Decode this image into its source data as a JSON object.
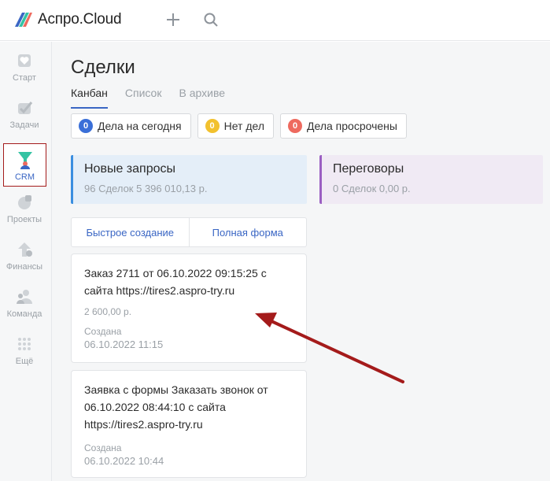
{
  "app": {
    "name": "Аспро.Cloud"
  },
  "topbar": {
    "icons": [
      "plus-icon",
      "search-icon"
    ]
  },
  "sidebar": {
    "items": [
      {
        "label": "Старт",
        "icon": "heart-icon"
      },
      {
        "label": "Задачи",
        "icon": "checkmark-icon"
      },
      {
        "label": "CRM",
        "icon": "funnel-icon",
        "active": true
      },
      {
        "label": "Проекты",
        "icon": "projects-icon"
      },
      {
        "label": "Финансы",
        "icon": "finance-icon"
      },
      {
        "label": "Команда",
        "icon": "team-icon"
      },
      {
        "label": "Ещё",
        "icon": "grid-dots-icon"
      }
    ]
  },
  "page": {
    "title": "Сделки",
    "tabs": [
      {
        "label": "Канбан",
        "active": true
      },
      {
        "label": "Список"
      },
      {
        "label": "В архиве"
      }
    ],
    "filters": [
      {
        "count": "0",
        "label": "Дела на сегодня",
        "color": "#3a6fd8"
      },
      {
        "count": "0",
        "label": "Нет дел",
        "color": "#f2c12e"
      },
      {
        "count": "0",
        "label": "Дела просрочены",
        "color": "#ee6a5f"
      }
    ]
  },
  "columns": [
    {
      "title": "Новые запросы",
      "meta": "96 Сделок   5 396 010,13 р.",
      "color": "#3a8ee0"
    },
    {
      "title": "Переговоры",
      "meta": "0 Сделок   0,00 р.",
      "color": "#9b5fc2"
    }
  ],
  "quick_actions": {
    "quick": "Быстрое создание",
    "full": "Полная форма"
  },
  "cards": [
    {
      "title": "Заказ 2711 от 06.10.2022 09:15:25 с сайта https://tires2.aspro-try.ru",
      "amount": "2 600,00 р.",
      "created_label": "Создана",
      "created": "06.10.2022 11:15"
    },
    {
      "title": "Заявка с формы Заказать звонок от 06.10.2022 08:44:10 с сайта https://tires2.aspro-try.ru",
      "created_label": "Создана",
      "created": "06.10.2022 10:44"
    }
  ],
  "annotation": {
    "arrow_color": "#a41b1b"
  }
}
